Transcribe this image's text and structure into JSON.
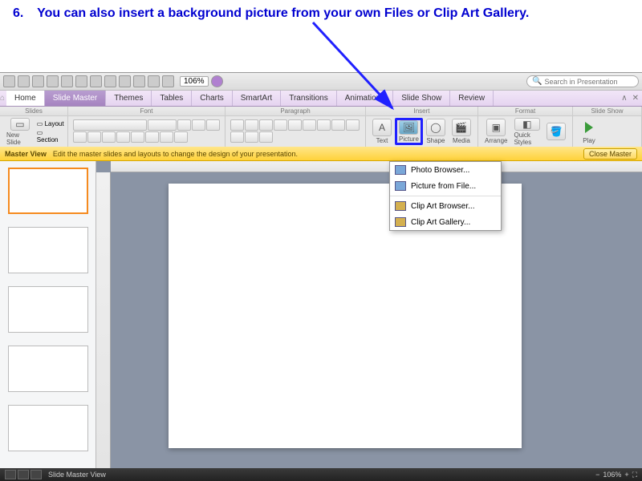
{
  "instruction": {
    "number": "6.",
    "text": "You can also insert a background picture from your own Files or Clip Art Gallery."
  },
  "qat": {
    "zoom": "106%",
    "search_placeholder": "Search in Presentation"
  },
  "tabs": {
    "home": "Home",
    "slide_master": "Slide Master",
    "themes": "Themes",
    "tables": "Tables",
    "charts": "Charts",
    "smartart": "SmartArt",
    "transitions": "Transitions",
    "animations": "Animations",
    "slide_show": "Slide Show",
    "review": "Review"
  },
  "group_headers": {
    "slides": "Slides",
    "font": "Font",
    "paragraph": "Paragraph",
    "insert": "Insert",
    "format": "Format",
    "slide_show": "Slide Show"
  },
  "ribbon": {
    "new_slide": "New Slide",
    "layout": "Layout",
    "section": "Section",
    "text": "Text",
    "picture": "Picture",
    "shape": "Shape",
    "media": "Media",
    "arrange": "Arrange",
    "quick_styles": "Quick Styles",
    "play": "Play"
  },
  "master_bar": {
    "label": "Master View",
    "hint": "Edit the master slides and layouts to change the design of your presentation.",
    "close": "Close Master"
  },
  "dropdown": {
    "photo_browser": "Photo Browser...",
    "picture_from_file": "Picture from File...",
    "clip_art_browser": "Clip Art Browser...",
    "clip_art_gallery": "Clip Art Gallery..."
  },
  "status": {
    "view_label": "Slide Master View",
    "zoom": "106%"
  }
}
